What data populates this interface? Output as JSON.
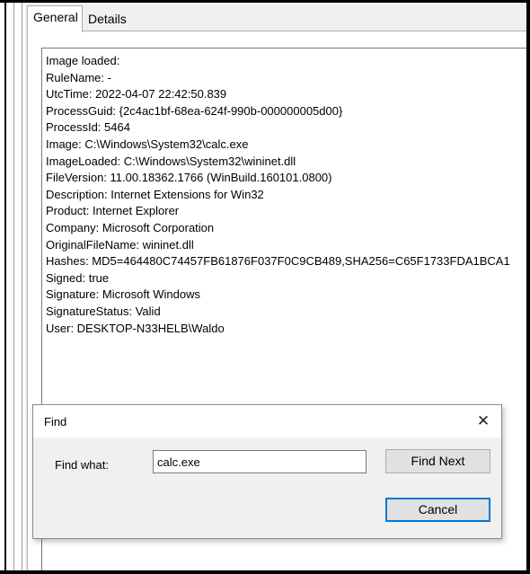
{
  "tabs": [
    {
      "label": "General"
    },
    {
      "label": "Details"
    }
  ],
  "event_lines": [
    "Image loaded:",
    "RuleName: -",
    "UtcTime: 2022-04-07 22:42:50.839",
    "ProcessGuid: {2c4ac1bf-68ea-624f-990b-000000005d00}",
    "ProcessId: 5464",
    "Image: C:\\Windows\\System32\\calc.exe",
    "ImageLoaded: C:\\Windows\\System32\\wininet.dll",
    "FileVersion: 11.00.18362.1766 (WinBuild.160101.0800)",
    "Description: Internet Extensions for Win32",
    "Product: Internet Explorer",
    "Company: Microsoft Corporation",
    "OriginalFileName: wininet.dll",
    "Hashes: MD5=464480C74457FB61876F037F0C9CB489,SHA256=C65F1733FDA1BCA1",
    "Signed: true",
    "Signature: Microsoft Windows",
    "SignatureStatus: Valid",
    "User: DESKTOP-N33HELB\\Waldo"
  ],
  "find_dialog": {
    "title": "Find",
    "close_glyph": "✕",
    "find_what_label": "Find what:",
    "find_what_value": "calc.exe",
    "find_next_label": "Find Next",
    "cancel_label": "Cancel"
  }
}
